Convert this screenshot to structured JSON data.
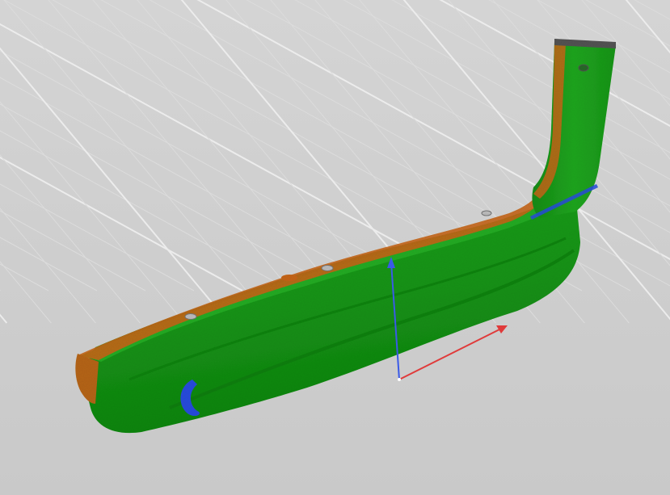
{
  "viewport": {
    "label": "",
    "background_color": "#cfcfcf",
    "grid_color_major": "#ececec",
    "grid_color_minor": "#dcdcdc"
  },
  "model": {
    "surface_color": "#1f9a1f",
    "surface_dark": "#178417",
    "edge_color": "#c86a1e",
    "edge_dark": "#8a4a1a",
    "deviation_blue": "#2a4de0",
    "deviation_red": "#e03a2a"
  },
  "axes": {
    "x_color": "#e03a3a",
    "y_color": "#3a5ae8",
    "z_color": "#2a5ae8"
  }
}
